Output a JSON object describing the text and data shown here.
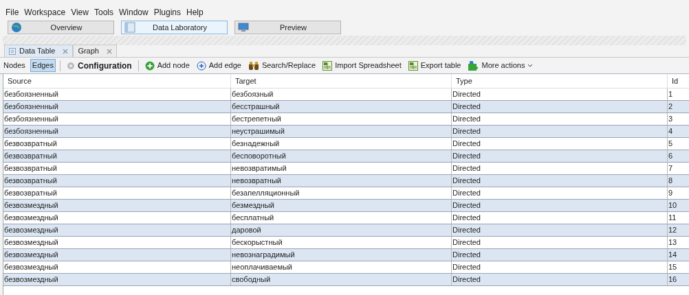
{
  "menu": [
    "File",
    "Workspace",
    "View",
    "Tools",
    "Window",
    "Plugins",
    "Help"
  ],
  "perspectives": [
    {
      "label": "Overview",
      "kind": "globe",
      "selected": false
    },
    {
      "label": "Data Laboratory",
      "kind": "table",
      "selected": true
    },
    {
      "label": "Preview",
      "kind": "monitor",
      "selected": false
    }
  ],
  "tabs": [
    {
      "label": "Data Table",
      "kind": "table",
      "selected": true
    },
    {
      "label": "Graph",
      "selected": false
    }
  ],
  "view_toggle": [
    {
      "label": "Nodes",
      "selected": false
    },
    {
      "label": "Edges",
      "selected": true
    }
  ],
  "toolbar": [
    {
      "label": "Configuration",
      "kind": "gear"
    },
    {
      "label": "Add node",
      "kind": "add-node"
    },
    {
      "label": "Add edge",
      "kind": "add-edge"
    },
    {
      "label": "Search/Replace",
      "kind": "binoculars"
    },
    {
      "label": "Import Spreadsheet",
      "kind": "sheet"
    },
    {
      "label": "Export table",
      "kind": "sheet"
    },
    {
      "label": "More actions",
      "kind": "puzzle"
    }
  ],
  "table": {
    "columns": [
      "Source",
      "Target",
      "Type",
      "Id"
    ],
    "rows": [
      [
        "безбоязненный",
        "безбоязный",
        "Directed",
        "1"
      ],
      [
        "безбоязненный",
        "бесстрашный",
        "Directed",
        "2"
      ],
      [
        "безбоязненный",
        "бестрепетный",
        "Directed",
        "3"
      ],
      [
        "безбоязненный",
        "неустрашимый",
        "Directed",
        "4"
      ],
      [
        "безвозвратный",
        "безнадежный",
        "Directed",
        "5"
      ],
      [
        "безвозвратный",
        "бесповоротный",
        "Directed",
        "6"
      ],
      [
        "безвозвратный",
        "невозвратимый",
        "Directed",
        "7"
      ],
      [
        "безвозвратный",
        "невозвратный",
        "Directed",
        "8"
      ],
      [
        "безвозвратный",
        "безапелляционный",
        "Directed",
        "9"
      ],
      [
        "безвозмездный",
        "безмездный",
        "Directed",
        "10"
      ],
      [
        "безвозмездный",
        "бесплатный",
        "Directed",
        "11"
      ],
      [
        "безвозмездный",
        "даровой",
        "Directed",
        "12"
      ],
      [
        "безвозмездный",
        "бескорыстный",
        "Directed",
        "13"
      ],
      [
        "безвозмездный",
        "невознаградимый",
        "Directed",
        "14"
      ],
      [
        "безвозмездный",
        "неоплачиваемый",
        "Directed",
        "15"
      ],
      [
        "безвозмездный",
        "свободный",
        "Directed",
        "16"
      ]
    ]
  }
}
